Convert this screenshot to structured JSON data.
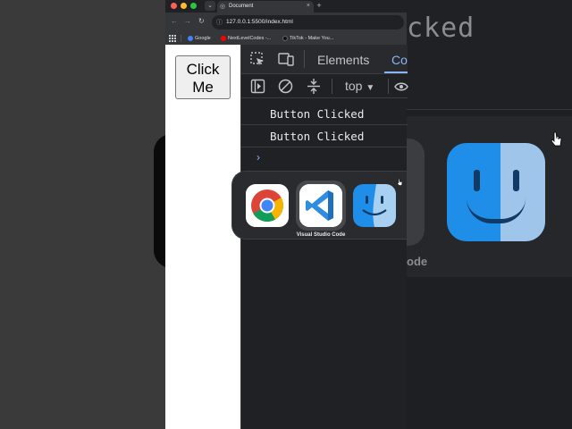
{
  "browser": {
    "tab_title": "Document",
    "url": "127.0.0.1:5500/index.html",
    "bookmarks": [
      {
        "label": "Google",
        "color": "#4285f4"
      },
      {
        "label": "NextLevelCodes -...",
        "color": "#ff0000"
      },
      {
        "label": "TikTok - Make You...",
        "color": "#111111"
      }
    ]
  },
  "page": {
    "button_label_line1": "Click",
    "button_label_line2": "Me"
  },
  "devtools": {
    "tabs": [
      "Elements",
      "Co"
    ],
    "active_tab": "Co",
    "context": "top",
    "logs": [
      "Button Clicked",
      "Button Clicked"
    ],
    "prompt": "›"
  },
  "app_switcher": {
    "apps": [
      {
        "name": "chrome-icon"
      },
      {
        "name": "vscode-icon"
      },
      {
        "name": "finder-icon"
      }
    ],
    "selected_label": "Visual Studio Code"
  },
  "background": {
    "title_fragment": "cked",
    "label_fragment": "ode"
  },
  "colors": {
    "accent": "#8ab4f8",
    "devtools_bg": "#202124",
    "vscode_blue": "#2f8ddf",
    "finder_blue": "#1f8ee8"
  }
}
